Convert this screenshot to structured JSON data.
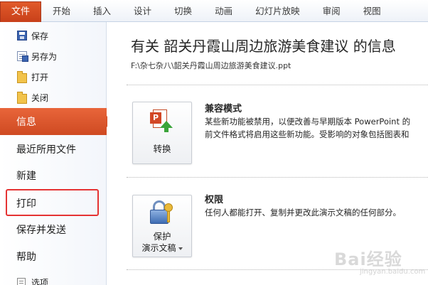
{
  "ribbon": {
    "file_tab": "文件",
    "tabs": [
      "开始",
      "插入",
      "设计",
      "切换",
      "动画",
      "幻灯片放映",
      "审阅",
      "视图"
    ]
  },
  "backstage": {
    "commands": [
      {
        "label": "保存",
        "icon": "save-icon"
      },
      {
        "label": "另存为",
        "icon": "save-as-icon"
      },
      {
        "label": "打开",
        "icon": "open-folder-icon"
      },
      {
        "label": "关闭",
        "icon": "close-folder-icon"
      }
    ],
    "menu": [
      {
        "label": "信息",
        "selected": true
      },
      {
        "label": "最近所用文件",
        "selected": false
      },
      {
        "label": "新建",
        "selected": false
      },
      {
        "label": "打印",
        "selected": false,
        "highlighted": true
      },
      {
        "label": "保存并发送",
        "selected": false
      },
      {
        "label": "帮助",
        "selected": false
      }
    ],
    "options_label": "选项"
  },
  "info": {
    "title": "有关 韶关丹霞山周边旅游美食建议 的信息",
    "path": "F:\\杂七杂八\\韶关丹霞山周边旅游美食建议.ppt",
    "compat": {
      "button_label": "转换",
      "title": "兼容模式",
      "text_line1": "某些新功能被禁用，以便改善与早期版本 PowerPoint 的",
      "text_line2": "前文件格式将启用这些新功能。受影响的对象包括图表和"
    },
    "permissions": {
      "button_line1": "保护",
      "button_line2": "演示文稿",
      "title": "权限",
      "text": "任何人都能打开、复制并更改此演示文稿的任何部分。"
    }
  },
  "watermark": {
    "text": "Bai经验",
    "sub": "jingyan.baidu.com"
  },
  "colors": {
    "accent": "#d65027",
    "highlight_box": "#e53333"
  }
}
